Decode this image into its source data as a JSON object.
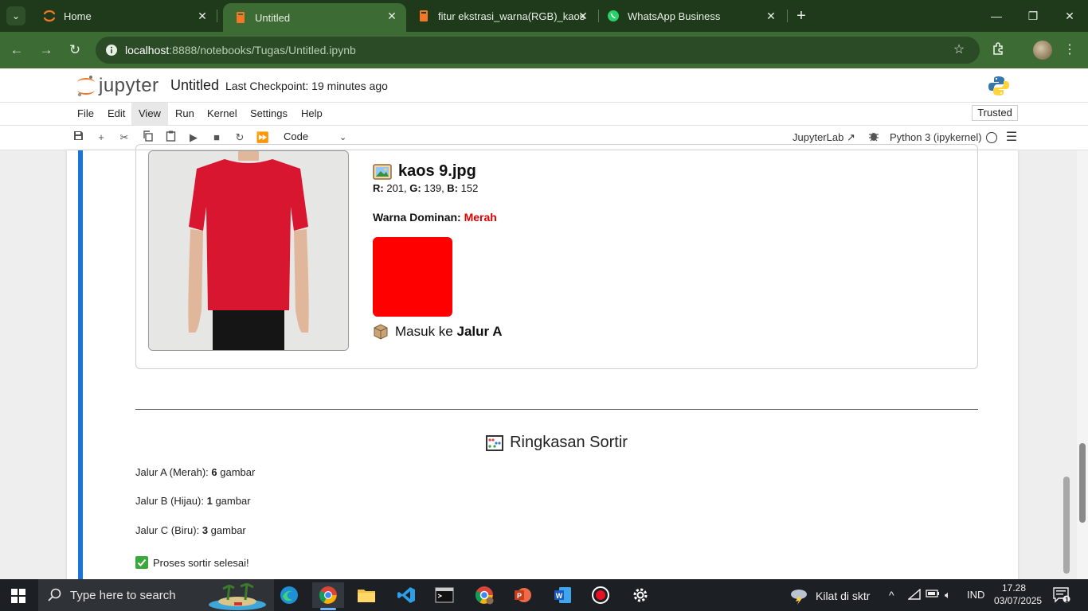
{
  "browser": {
    "tabs": [
      {
        "label": "Home",
        "icon": "jupyter-icon"
      },
      {
        "label": "Untitled",
        "icon": "notebook-icon",
        "active": true
      },
      {
        "label": "fitur ekstrasi_warna(RGB)_kaos",
        "icon": "notebook-icon"
      },
      {
        "label": "WhatsApp Business",
        "icon": "whatsapp-icon"
      }
    ],
    "url_host": "localhost",
    "url_rest": ":8888/notebooks/Tugas/Untitled.ipynb"
  },
  "jupyter": {
    "brand": "jupyter",
    "notebook_title": "Untitled",
    "checkpoint": "Last Checkpoint: 19 minutes ago",
    "menu": [
      "File",
      "Edit",
      "View",
      "Run",
      "Kernel",
      "Settings",
      "Help"
    ],
    "trusted": "Trusted",
    "cell_type": "Code",
    "jupyterlab_label": "JupyterLab",
    "kernel_label": "Python 3 (ipykernel)"
  },
  "output": {
    "file_name": "kaos 9.jpg",
    "r_label": "R:",
    "r_value": "201",
    "g_label": "G:",
    "g_value": "139",
    "b_label": "B:",
    "b_value": "152",
    "dominant_label": "Warna Dominan:",
    "dominant_value": "Merah",
    "swatch_color": "#ff0000",
    "lane_prefix": "Masuk ke",
    "lane_value": "Jalur A"
  },
  "summary": {
    "title": "Ringkasan Sortir",
    "rows": [
      {
        "label": "Jalur A (Merah):",
        "count": "6",
        "unit": "gambar"
      },
      {
        "label": "Jalur B (Hijau):",
        "count": "1",
        "unit": "gambar"
      },
      {
        "label": "Jalur C (Biru):",
        "count": "3",
        "unit": "gambar"
      }
    ],
    "done": "Proses sortir selesai!"
  },
  "taskbar": {
    "search_placeholder": "Type here to search",
    "weather": "Kilat di sktr",
    "language": "IND",
    "time": "17.28",
    "date": "03/07/2025",
    "notifications": "1"
  }
}
